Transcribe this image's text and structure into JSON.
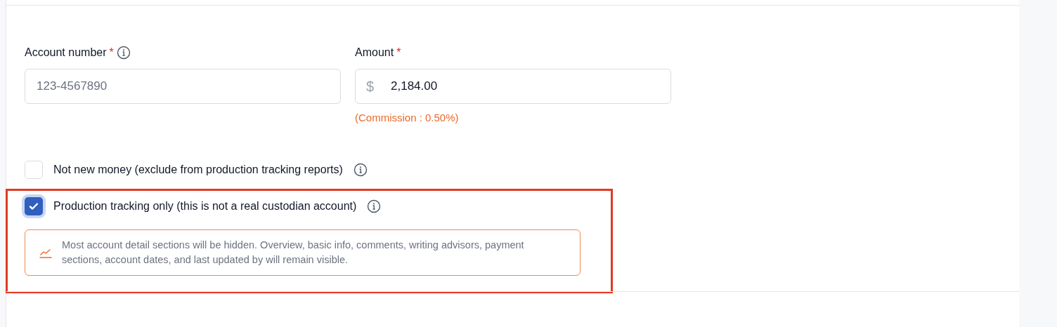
{
  "fields": [
    {
      "label": "Account number",
      "required_mark": "*",
      "info": true,
      "placeholder": "123-4567890"
    },
    {
      "label": "Amount",
      "required_mark": "*",
      "info": false,
      "prefix": "$",
      "value": "2,184.00",
      "hint": "(Commission : 0.50%)"
    }
  ],
  "options": [
    {
      "label": "Not new money (exclude from production tracking reports)",
      "checked": false,
      "highlighted": false
    },
    {
      "label": "Production tracking only (this is not a real custodian account)",
      "checked": true,
      "highlighted": true,
      "notice": "Most account detail sections will be hidden. Overview, basic info, comments, writing advisors, payment sections, account dates, and last updated by will remain visible."
    }
  ]
}
